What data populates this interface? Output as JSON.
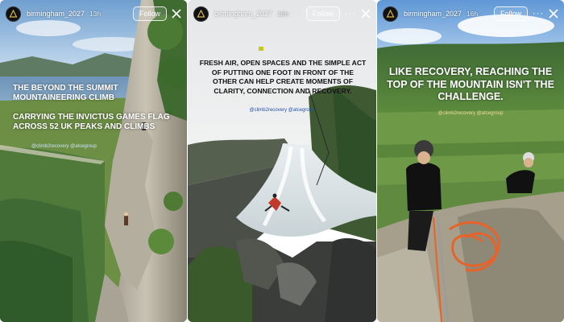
{
  "stories": [
    {
      "username": "birmingham_2027",
      "time": "13h",
      "follow_label": "Follow",
      "headline": "THE BEYOND THE SUMMIT MOUNTAINEERING CLIMB",
      "subheadline": "CARRYING THE INVICTUS GAMES FLAG ACROSS 52 UK PEAKS AND CLIMBS",
      "tags": "@climb2recovery @atcegroup"
    },
    {
      "username": "birmingham_2027",
      "time": "16h",
      "follow_label": "Follow",
      "more_icon": "more-options-icon",
      "caption": "FRESH AIR, OPEN SPACES AND THE SIMPLE ACT OF PUTTING ONE FOOT IN FRONT OF THE OTHER CAN HELP CREATE MOMENTS OF CLARITY, CONNECTION AND RECOVERY.",
      "tags": "@climb2recovery @atcegroup"
    },
    {
      "username": "birmingham_2027",
      "time": "16h",
      "follow_label": "Follow",
      "more_icon": "more-options-icon",
      "caption": "LIKE RECOVERY, REACHING THE TOP OF THE MOUNTAIN ISN'T THE CHALLENGE.",
      "tags": "@climb2recovery @atcegroup"
    }
  ],
  "colors": {
    "text_light": "#ffffff",
    "caption_dark": "#111111",
    "tag_blue": "#1f4fb0",
    "tag_gold": "#f2d79a",
    "rope_orange": "#e8622a"
  }
}
